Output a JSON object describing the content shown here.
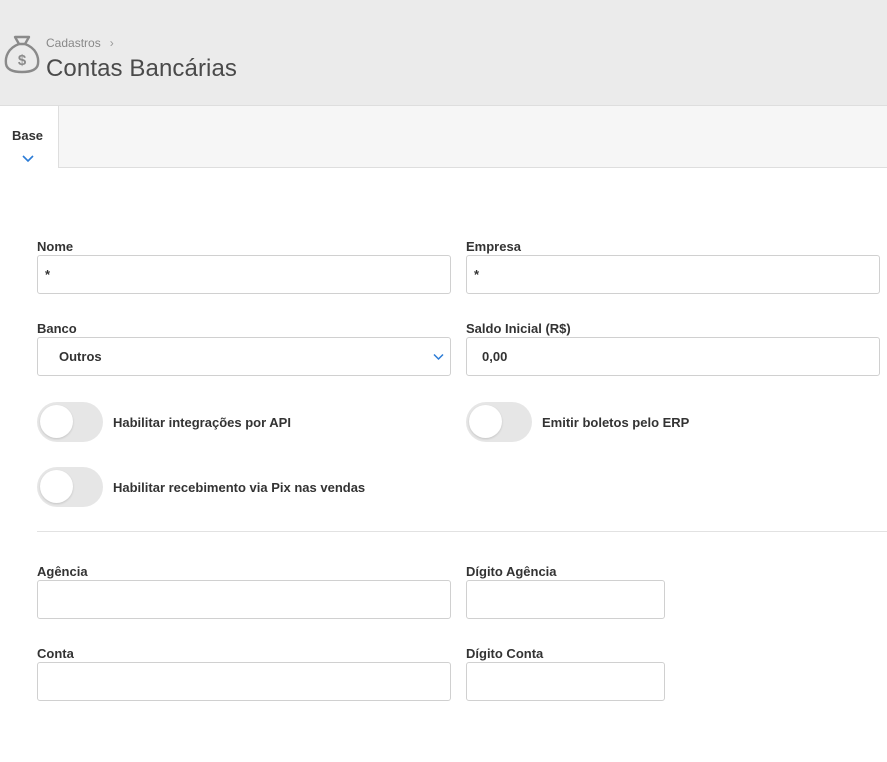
{
  "header": {
    "icon": "money-bag-icon",
    "breadcrumb": "Cadastros",
    "breadcrumb_separator": "›",
    "title": "Contas Bancárias"
  },
  "tabs": [
    {
      "label": "Base",
      "active": true,
      "icon": "chevron-down-icon"
    }
  ],
  "form": {
    "nome": {
      "label": "Nome",
      "value": "*"
    },
    "empresa": {
      "label": "Empresa",
      "value": "*"
    },
    "banco": {
      "label": "Banco",
      "value": "Outros"
    },
    "saldo_inicial": {
      "label": "Saldo Inicial (R$)",
      "value": "0,00"
    },
    "toggles": {
      "api": {
        "label": "Habilitar integrações por API",
        "on": false
      },
      "boletos": {
        "label": "Emitir boletos pelo ERP",
        "on": false
      },
      "pix": {
        "label": "Habilitar recebimento via Pix nas vendas",
        "on": false
      }
    },
    "agencia": {
      "label": "Agência",
      "value": ""
    },
    "digito_agencia": {
      "label": "Dígito Agência",
      "value": ""
    },
    "conta": {
      "label": "Conta",
      "value": ""
    },
    "digito_conta": {
      "label": "Dígito Conta",
      "value": ""
    }
  },
  "colors": {
    "accent": "#2b7bd6",
    "toggle_off": "#e6e6e6",
    "header_bg": "#ebebeb"
  }
}
